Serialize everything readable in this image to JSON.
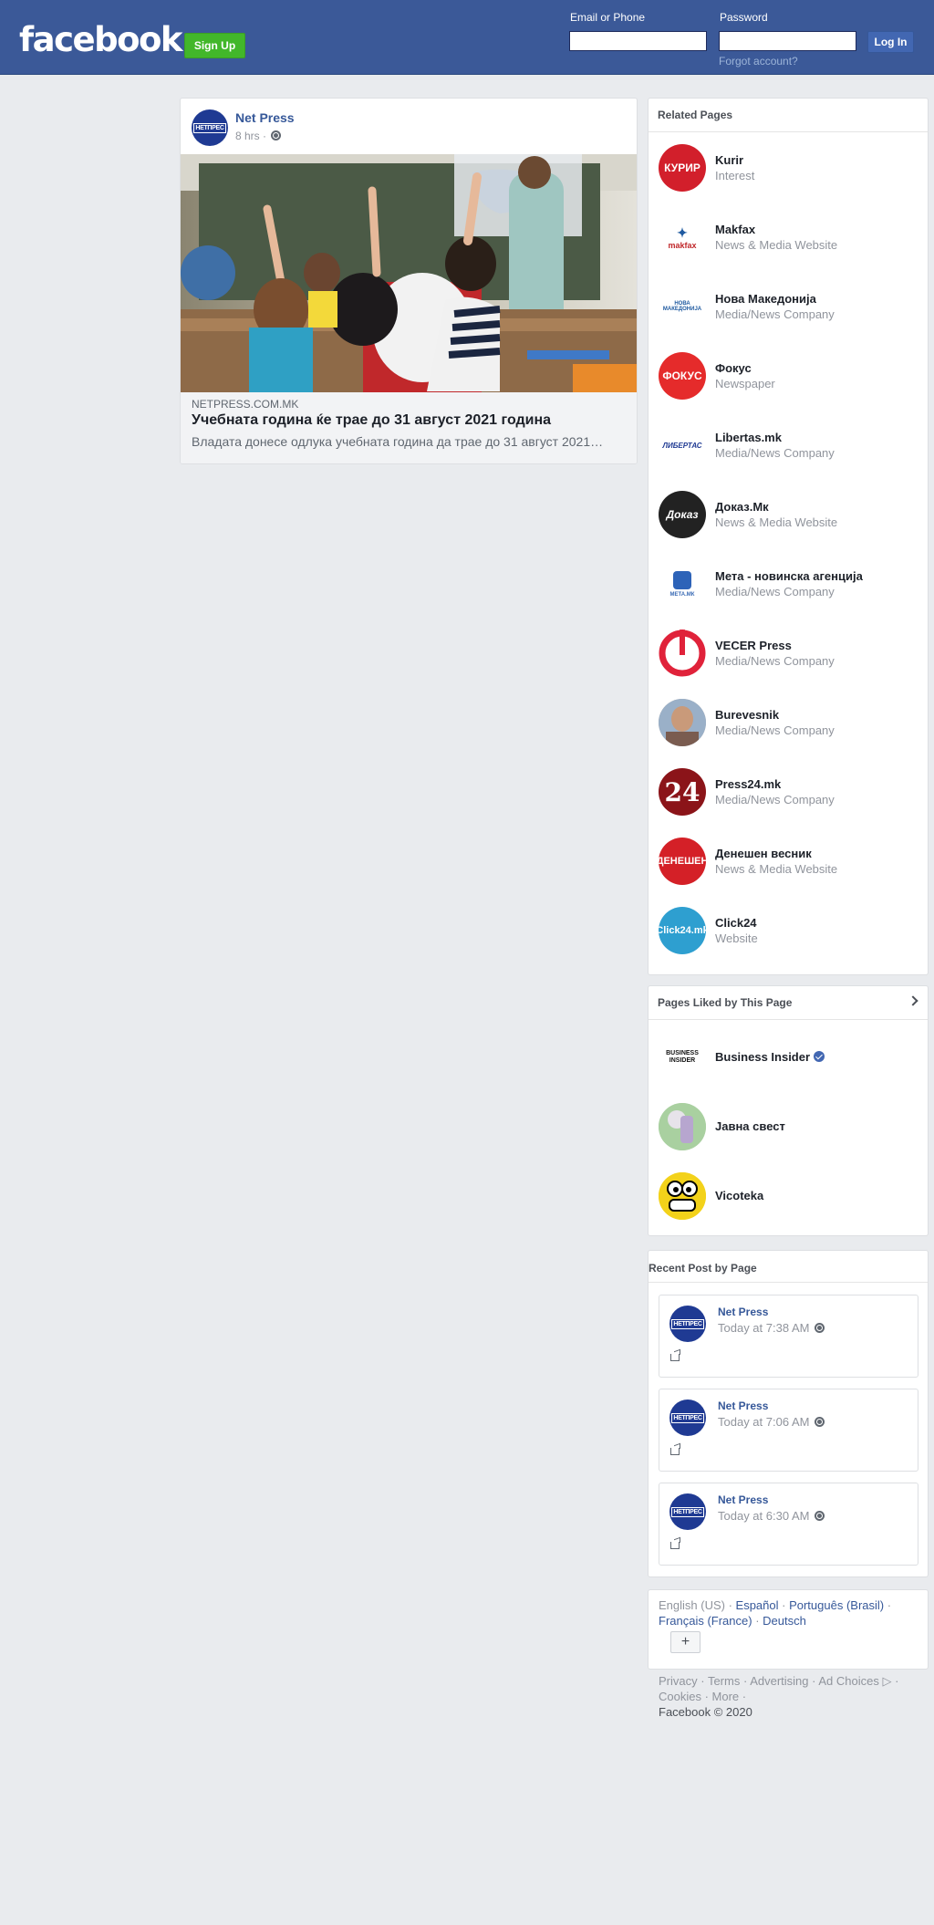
{
  "header": {
    "logo": "facebook",
    "signup_label": "Sign Up",
    "email_label": "Email or Phone",
    "password_label": "Password",
    "email_value": "",
    "password_value": "",
    "login_label": "Log In",
    "forgot_label": "Forgot account?"
  },
  "post": {
    "page_name": "Net Press",
    "avatar_text": "НЕТПРЕС",
    "time": "8 hrs · ",
    "link_domain": "NETPRESS.COM.MK",
    "link_title": "Учебната година ќе трае до 31 август 2021 година",
    "link_desc": "Владата донесе одлука учебната година да трае до 31 август 2021…"
  },
  "related": {
    "title": "Related Pages",
    "items": [
      {
        "name": "Kurir",
        "category": "Interest",
        "avatar_text": "КУРИР",
        "color": "#d21f2b"
      },
      {
        "name": "Makfax",
        "category": "News & Media Website",
        "avatar_text": "makfax",
        "color": "#ffffff"
      },
      {
        "name": "Нова Македонија",
        "category": "Media/News Company",
        "avatar_text": "НОВА МАКЕДОНИЈА",
        "color": "#ffffff"
      },
      {
        "name": "Фокус",
        "category": "Newspaper",
        "avatar_text": "ФОКУС",
        "color": "#e52b2b"
      },
      {
        "name": "Libertas.mk",
        "category": "Media/News Company",
        "avatar_text": "ЛИБЕРТАС",
        "color": "#ffffff"
      },
      {
        "name": "Доказ.Мк",
        "category": "News & Media Website",
        "avatar_text": "Доказ",
        "color": "#222222"
      },
      {
        "name": "Мета - новинска агенција",
        "category": "Media/News Company",
        "avatar_text": "МЕТА.МК",
        "color": "#ffffff"
      },
      {
        "name": "VECER Press",
        "category": "Media/News Company",
        "avatar_text": "",
        "color": "#e0223a"
      },
      {
        "name": "Burevesnik",
        "category": "Media/News Company",
        "avatar_text": "",
        "color": "#a07860"
      },
      {
        "name": "Press24.mk",
        "category": "Media/News Company",
        "avatar_text": "24",
        "color": "#8b1419"
      },
      {
        "name": "Денешен весник",
        "category": "News & Media Website",
        "avatar_text": "ДЕНЕШЕН",
        "color": "#d42027"
      },
      {
        "name": "Click24",
        "category": "Website",
        "avatar_text": "Click24.mk",
        "color": "#2e9fd0"
      }
    ]
  },
  "liked": {
    "title": "Pages Liked by This Page",
    "items": [
      {
        "name": "Business Insider",
        "avatar_text": "BUSINESS INSIDER",
        "verified": true
      },
      {
        "name": "Јавна свест",
        "avatar_text": ""
      },
      {
        "name": "Vicoteka",
        "avatar_text": ""
      }
    ]
  },
  "recent": {
    "title": "Recent Post by Page",
    "items": [
      {
        "name": "Net Press",
        "time": "Today at 7:38 AM"
      },
      {
        "name": "Net Press",
        "time": "Today at 7:06 AM"
      },
      {
        "name": "Net Press",
        "time": "Today at 6:30 AM"
      }
    ]
  },
  "languages": {
    "current": "English (US)",
    "links": [
      "Español",
      "Português (Brasil)",
      "Français (France)",
      "Deutsch"
    ],
    "plus": "+"
  },
  "footer": {
    "links": [
      "Privacy",
      "Terms",
      "Advertising",
      "Ad Choices",
      "Cookies",
      "More"
    ],
    "copyright": "Facebook © 2020"
  }
}
